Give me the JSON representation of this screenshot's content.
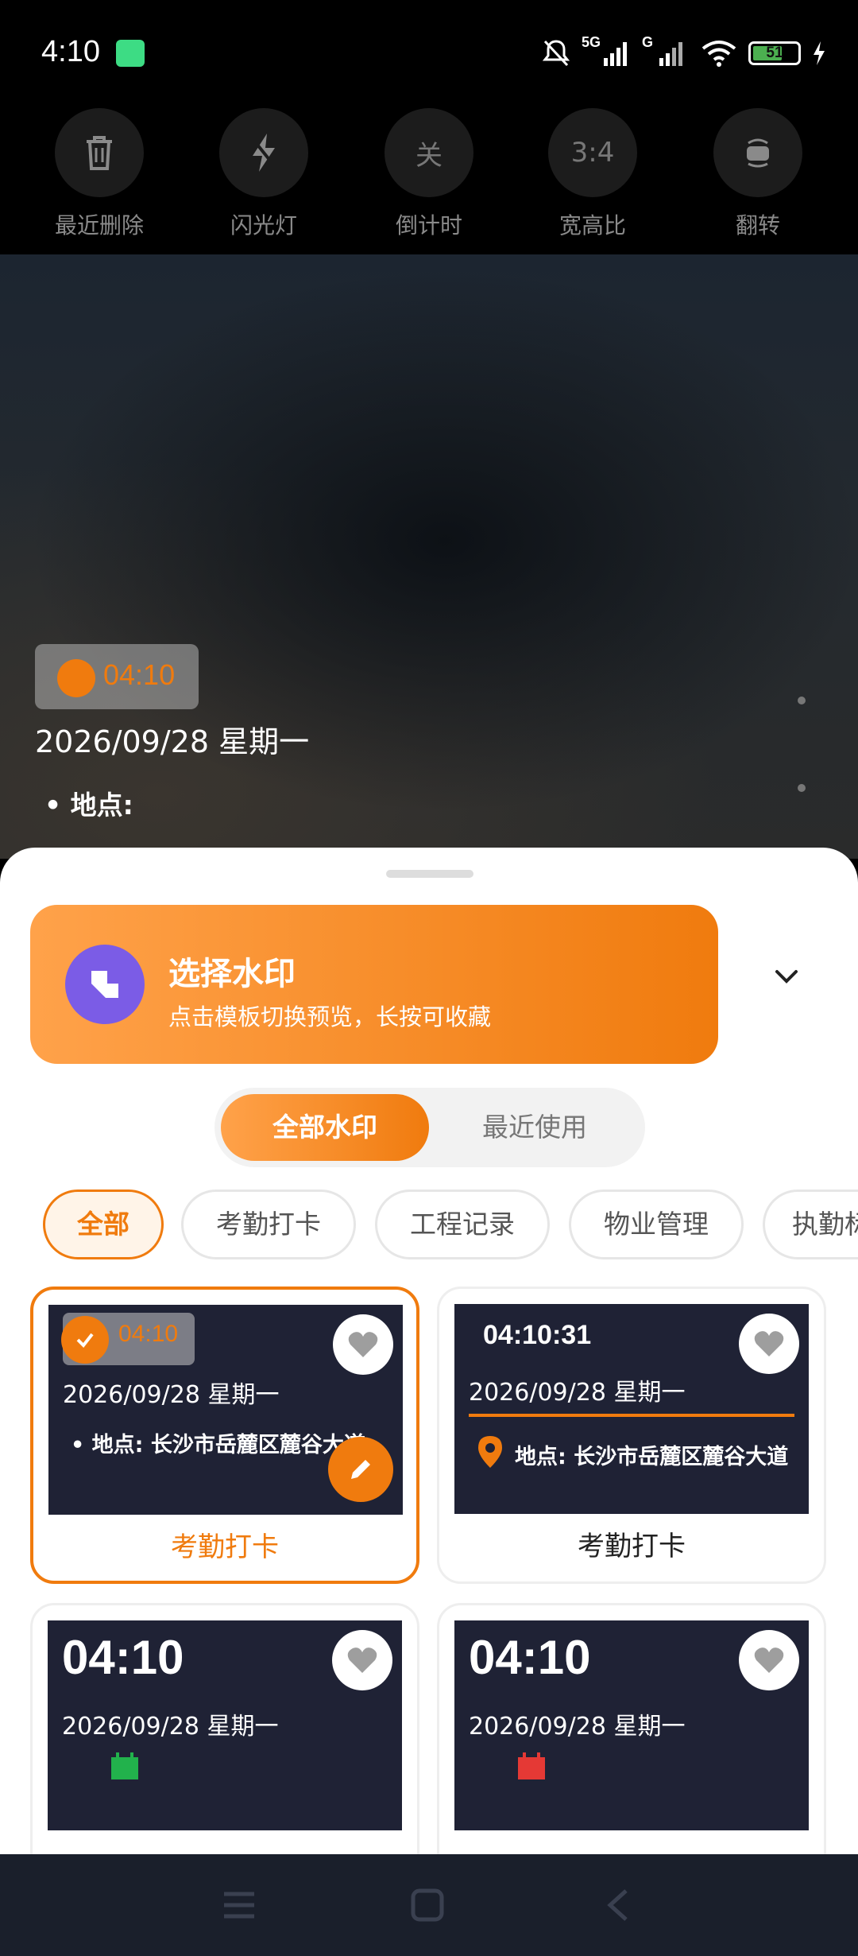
{
  "status_bar": {
    "time": "4:10",
    "network_label": "5G",
    "network_label_2": "G",
    "battery_level": "51",
    "colors": {
      "battery_fill": "#4caf50",
      "android_badge": "#3ddc84"
    }
  },
  "camera_tools": [
    {
      "label": "最近删除",
      "glyph": "trash-icon"
    },
    {
      "label": "闪光灯",
      "glyph": "flash-off-icon"
    },
    {
      "label": "倒计时",
      "glyph_text": "关"
    },
    {
      "label": "宽高比",
      "glyph_text": "3:4"
    },
    {
      "label": "翻转",
      "glyph": "flip-camera-icon"
    }
  ],
  "preview_watermark": {
    "time": "04:10",
    "date": "2026/09/28 星期一",
    "place_label": "• 地点:"
  },
  "sheet": {
    "title": "选择水印",
    "subtitle": "点击模板切换预览，长按可收藏",
    "segments": {
      "active": "全部水印",
      "inactive": "最近使用"
    },
    "categories": [
      "全部",
      "考勤打卡",
      "工程记录",
      "物业管理",
      "执勤标"
    ],
    "templates": [
      {
        "label": "考勤打卡",
        "time": "04:10",
        "date": "2026/09/28 星期一",
        "place": "• 地点: 长沙市岳麓区麓谷大道"
      },
      {
        "label": "考勤打卡",
        "time": "04:10:31",
        "date": "2026/09/28 星期一",
        "place": "地点: 长沙市岳麓区麓谷大道"
      },
      {
        "time": "04:10",
        "date": "2026/09/28 星期一",
        "icon": "calendar-icon",
        "icon_color": "#22b24c"
      },
      {
        "time": "04:10",
        "date": "2026/09/28 星期一",
        "icon": "calendar-icon",
        "icon_color": "#e53935"
      }
    ]
  },
  "colors": {
    "accent": "#f07b0e",
    "accent_light": "#ffa24a",
    "banner_icon_bg": "#7b5ce6",
    "thumb_bg": "#1f2235"
  }
}
